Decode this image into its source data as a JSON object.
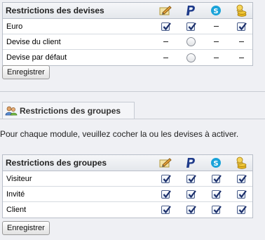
{
  "currency_table": {
    "title": "Restrictions des devises",
    "modules": [
      "pencil-module-icon",
      "paypal-module-icon",
      "skrill-module-icon",
      "coins-module-icon"
    ],
    "rows": [
      {
        "label": "Euro",
        "cells": [
          "checked",
          "checked",
          "none",
          "checked"
        ]
      },
      {
        "label": "Devise du client",
        "cells": [
          "none",
          "radio",
          "none",
          "none"
        ]
      },
      {
        "label": "Devise par défaut",
        "cells": [
          "none",
          "radio",
          "none",
          "none"
        ]
      }
    ],
    "save_label": "Enregistrer"
  },
  "group_section": {
    "tab_title": "Restrictions des groupes",
    "intro": "Pour chaque module, veuillez cocher la ou les devises à activer."
  },
  "group_table": {
    "title": "Restrictions des groupes",
    "rows": [
      {
        "label": "Visiteur",
        "cells": [
          "checked",
          "checked",
          "checked",
          "checked"
        ]
      },
      {
        "label": "Invité",
        "cells": [
          "checked",
          "checked",
          "checked",
          "checked"
        ]
      },
      {
        "label": "Client",
        "cells": [
          "checked",
          "checked",
          "checked",
          "checked"
        ]
      }
    ],
    "save_label": "Enregistrer"
  },
  "colors": {
    "background": "#eff0f4",
    "checkbox_tick": "#1b2f6b",
    "paypal": "#1e3a8a",
    "skrill": "#1aa3d9",
    "coins": "#e8b820"
  }
}
